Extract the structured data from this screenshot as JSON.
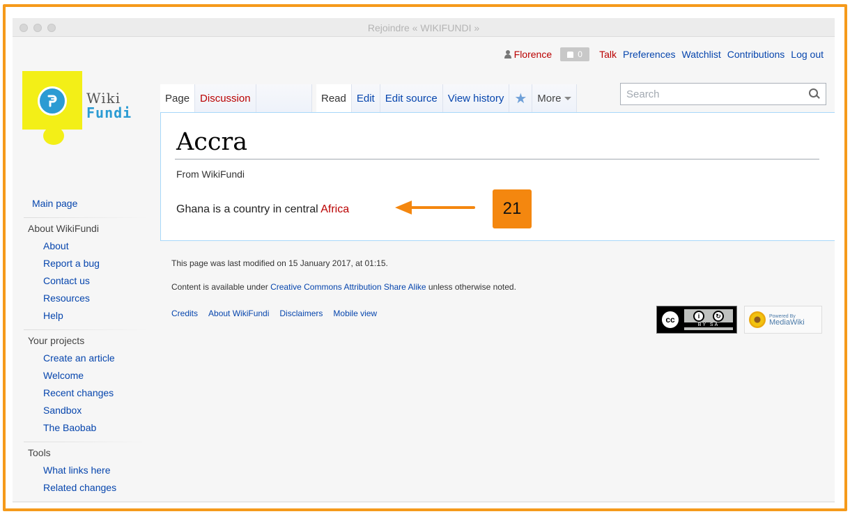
{
  "window": {
    "title": "Rejoindre « WIKIFUNDI »"
  },
  "personal": {
    "username": "Florence",
    "notifications": "0",
    "links": [
      "Talk",
      "Preferences",
      "Watchlist",
      "Contributions",
      "Log out"
    ]
  },
  "logo": {
    "wiki": "Wiki",
    "fundi": "Fundi"
  },
  "tabs": {
    "page": "Page",
    "discussion": "Discussion",
    "read": "Read",
    "edit": "Edit",
    "edit_source": "Edit source",
    "view_history": "View history",
    "more": "More"
  },
  "search": {
    "placeholder": "Search",
    "value": ""
  },
  "article": {
    "title": "Accra",
    "from": "From WikiFundi",
    "text": "Ghana is a country in central ",
    "link": "Africa",
    "badge": "21"
  },
  "sidebar": {
    "main_page": "Main page",
    "portals": [
      {
        "heading": "About WikiFundi",
        "items": [
          "About",
          "Report a bug",
          "Contact us",
          "Resources",
          "Help"
        ]
      },
      {
        "heading": "Your projects",
        "items": [
          "Create an article",
          "Welcome",
          "Recent changes",
          "Sandbox",
          "The Baobab"
        ]
      },
      {
        "heading": "Tools",
        "items": [
          "What links here",
          "Related changes"
        ]
      }
    ]
  },
  "footer": {
    "last_modified": "This page was last modified on 15 January 2017, at 01:15.",
    "license_prefix": "Content is available under ",
    "license_link": "Creative Commons Attribution Share Alike",
    "license_suffix": " unless otherwise noted.",
    "links": [
      "Credits",
      "About WikiFundi",
      "Disclaimers",
      "Mobile view"
    ],
    "cc": {
      "cc": "cc",
      "by": "BY",
      "sa": "SA"
    },
    "mediawiki": {
      "powered": "Powered By",
      "name": "MediaWiki"
    }
  },
  "colors": {
    "accent_orange": "#f4870f",
    "link_blue": "#0645ad",
    "link_red": "#ba0000",
    "logo_yellow": "#f3ef17",
    "logo_blue": "#2b9bd3"
  }
}
